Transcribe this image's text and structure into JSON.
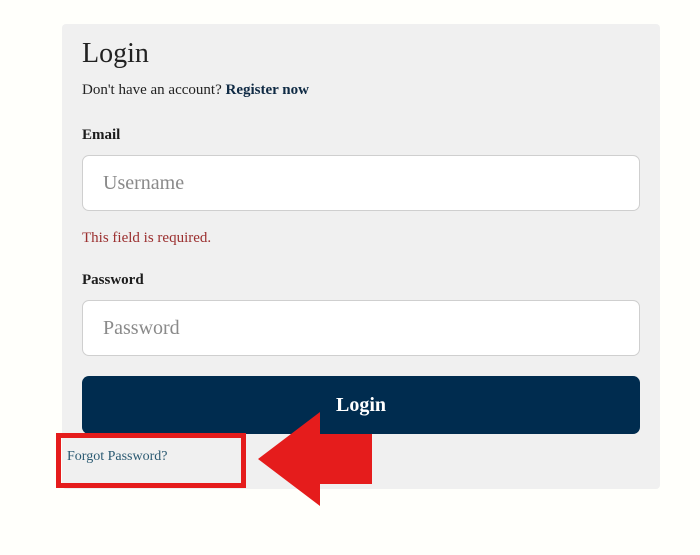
{
  "login_card": {
    "title": "Login",
    "register_prompt": "Don't have an account?",
    "register_link": "Register now",
    "email_label": "Email",
    "username_placeholder": "Username",
    "username_value": "",
    "email_error": "This field is required.",
    "password_label": "Password",
    "password_placeholder": "Password",
    "password_value": "",
    "login_button": "Login",
    "forgot_password_link": "Forgot Password?"
  },
  "annotation": {
    "highlight_color": "#e51c1c",
    "arrow_color": "#e51c1c",
    "arrow_icon": "arrow-left-icon"
  }
}
